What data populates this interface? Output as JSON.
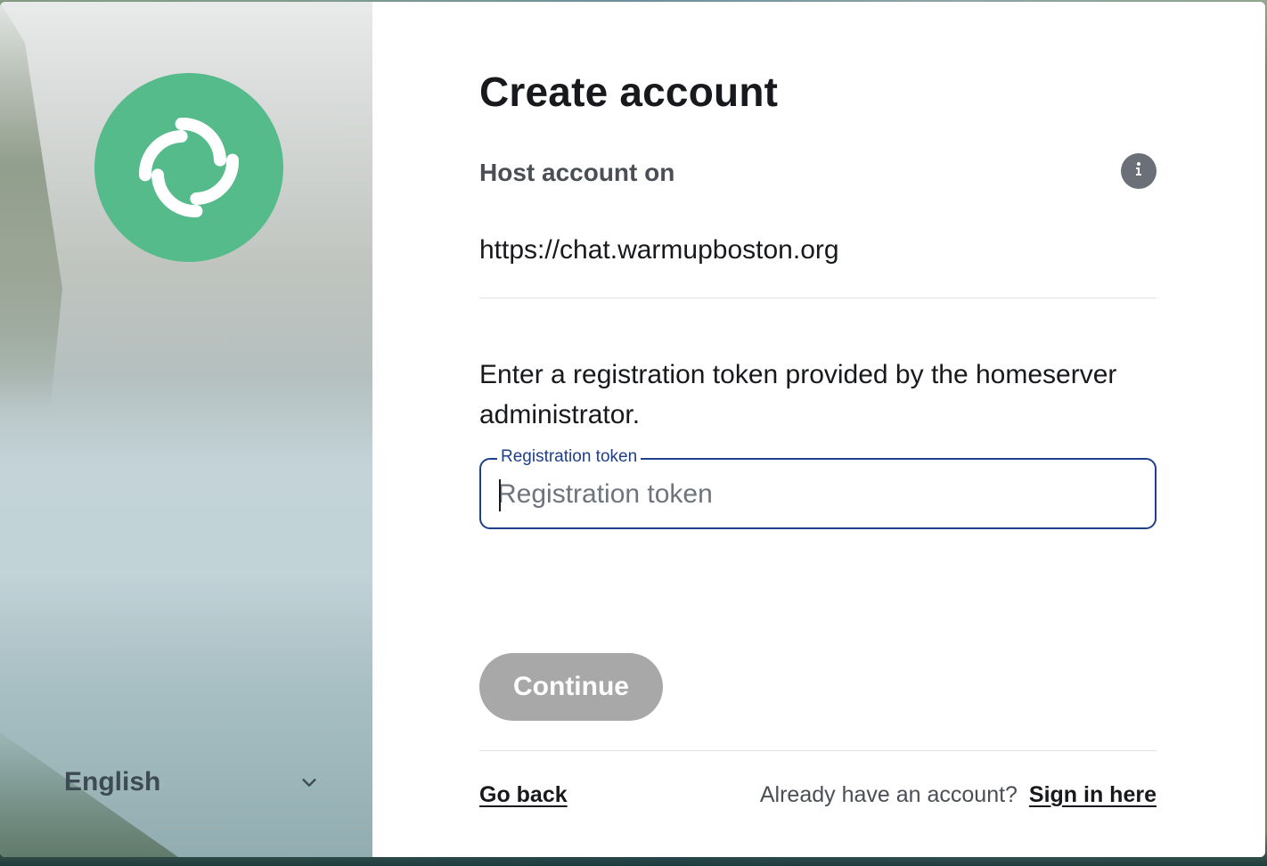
{
  "auth": {
    "title": "Create account",
    "host_label": "Host account on",
    "server_url": "https://chat.warmupboston.org",
    "description": "Enter a registration token provided by the homeserver administrator.",
    "token_field": {
      "label": "Registration token",
      "placeholder": "Registration token",
      "value": ""
    },
    "continue_label": "Continue",
    "go_back_label": "Go back",
    "signin_prompt": "Already have an account?",
    "signin_link": "Sign in here"
  },
  "language": {
    "selected": "English"
  },
  "icons": {
    "logo": "element-logo-icon",
    "info": "info-icon",
    "language_dropdown": "chevron-down-icon"
  },
  "colors": {
    "logo_green": "#55bb8a",
    "field_border": "#1f3f8a",
    "button_disabled": "#a8a8a8",
    "info_icon_bg": "#6a6f78"
  }
}
